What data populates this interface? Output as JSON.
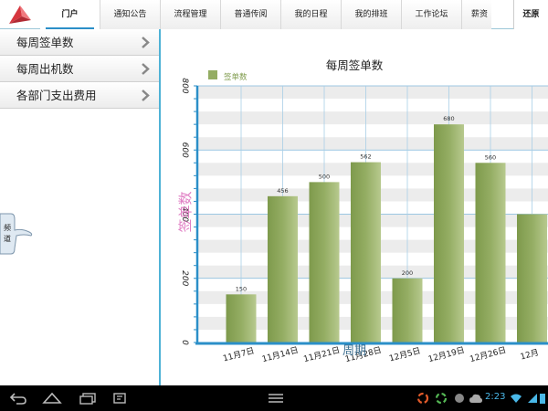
{
  "app": {
    "tabs": [
      "门户",
      "通知公告",
      "流程管理",
      "普通传阅",
      "我的日程",
      "我的排班",
      "工作论坛"
    ],
    "active_tab": 0,
    "partial_tab": "薪资",
    "restore_label": "还原",
    "colors": {
      "brand": "#d6363f",
      "accent": "#2b8fc8",
      "bar": "#94ad63",
      "ylabel": "#e07fc4"
    }
  },
  "sidebar": {
    "items": [
      {
        "label": "每周签单数",
        "icon": "chevron-right-icon"
      },
      {
        "label": "每周出机数",
        "icon": "chevron-right-icon"
      },
      {
        "label": "各部门支出费用",
        "icon": "chevron-right-icon"
      }
    ],
    "channel_label": [
      "频",
      "道"
    ]
  },
  "chart_data": {
    "type": "bar",
    "title": "每周签单数",
    "xlabel": "周期",
    "ylabel": "签单数",
    "legend": {
      "entries": [
        "签单数"
      ],
      "placement": "top-left"
    },
    "categories": [
      "11月7日",
      "11月14日",
      "11月21日",
      "11月28日",
      "12月5日",
      "12月19日",
      "12月26日",
      "12月"
    ],
    "series": [
      {
        "name": "签单数",
        "values": [
          150,
          456,
          500,
          562,
          200,
          680,
          560,
          400
        ]
      }
    ],
    "data_labels": [
      "150",
      "456",
      "500",
      "562",
      "200",
      "680",
      "560",
      ""
    ],
    "yticks": [
      0,
      200,
      400,
      600,
      800
    ],
    "ytick_labels": [
      "0",
      "200",
      "400",
      "600",
      "800"
    ],
    "ylim": [
      0,
      800
    ],
    "grid": true
  },
  "statusbar": {
    "time": "2:23",
    "icons": [
      "back-icon",
      "home-icon",
      "recent-apps-icon",
      "screenshot-icon",
      "menu-icon",
      "app-icon",
      "app-icon",
      "app-icon",
      "cloud-icon",
      "wifi-icon",
      "battery-icon"
    ]
  }
}
